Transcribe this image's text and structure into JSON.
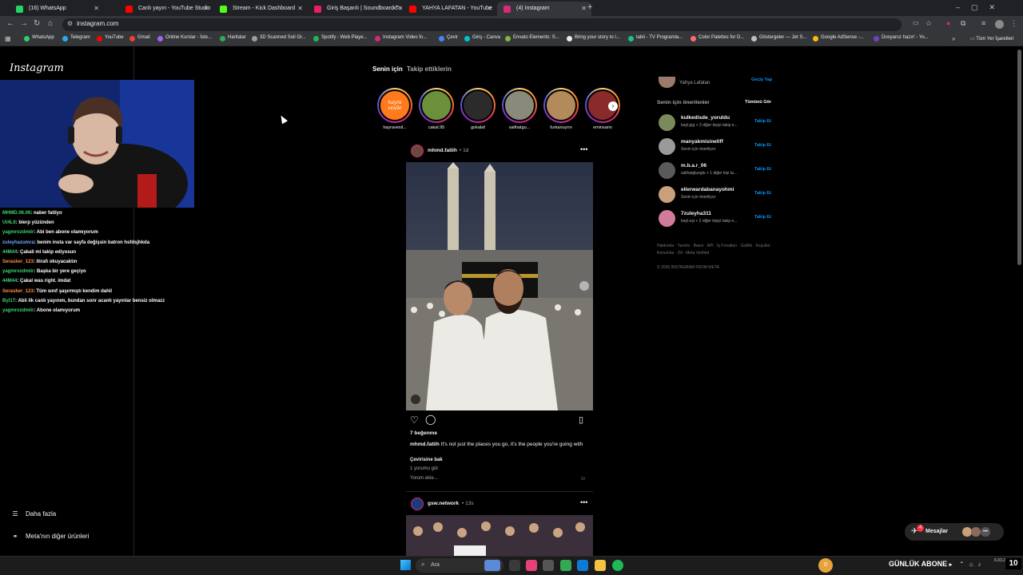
{
  "tabs": [
    {
      "title": "(16) WhatsApp",
      "color": "#25d366"
    },
    {
      "title": "Canlı yayın - YouTube Studio",
      "color": "#ff0000"
    },
    {
      "title": "Stream - Kick Dashboard",
      "color": "#53fc18"
    },
    {
      "title": "Giriş Başarılı | Soundboard Tarı",
      "color": "#e91e63"
    },
    {
      "title": "YAHYA LAFATAN - YouTube",
      "color": "#ff0000"
    },
    {
      "title": "(4) Instagram",
      "color": "#d62976"
    }
  ],
  "new_tab_label": "+",
  "address": {
    "url": "instagram.com"
  },
  "bookmarks": [
    {
      "label": "WhatsApp",
      "color": "#25d366"
    },
    {
      "label": "Telegram",
      "color": "#2aabee"
    },
    {
      "label": "YouTube",
      "color": "#ff0000"
    },
    {
      "label": "Gmail",
      "color": "#ea4335"
    },
    {
      "label": "Online Kurslar - İste...",
      "color": "#a463f2"
    },
    {
      "label": "Haritalar",
      "color": "#34a853"
    },
    {
      "label": "3D Scanned Soil Gr...",
      "color": "#9aa0a6"
    },
    {
      "label": "Spotify - Web Playe...",
      "color": "#1db954"
    },
    {
      "label": "Instagram Video İn...",
      "color": "#d62976"
    },
    {
      "label": "Çevir",
      "color": "#4285f4"
    },
    {
      "label": "Giriş - Canva",
      "color": "#00c4cc"
    },
    {
      "label": "Envato Elements: S...",
      "color": "#82b541"
    },
    {
      "label": "Bring your story to l...",
      "color": "#e8eaed"
    },
    {
      "label": "tabii - TV Programla...",
      "color": "#19c37d"
    },
    {
      "label": "Color Palettes for D...",
      "color": "#ff6b6b"
    },
    {
      "label": "Göstergeler — Jet S...",
      "color": "#bdc1c6"
    },
    {
      "label": "Google AdSense -...",
      "color": "#fbbc04"
    },
    {
      "label": "Dosyanız hazır! - Yo...",
      "color": "#6f42c1"
    }
  ],
  "bookmarks_overflow": "»",
  "all_bookmarks": "Tüm Yer İşaretleri",
  "instagram": {
    "logo": "Instagram",
    "feed_tabs": [
      "Senin için",
      "Takip ettiklerin"
    ],
    "stories": [
      {
        "user": "hayravesil...",
        "color": "#ff7a1a",
        "label": "hayra vesile"
      },
      {
        "user": "cakal.95",
        "color": "#6b8f3a"
      },
      {
        "user": "gokalaf",
        "color": "#2b2b2b"
      },
      {
        "user": "salihatgu...",
        "color": "#8a8a7a"
      },
      {
        "user": "furkanuyrın",
        "color": "#b38a5a"
      },
      {
        "user": "eminsann",
        "color": "#8a2b2b"
      }
    ],
    "post": {
      "author": "mhmd.fatiih",
      "time": "1d",
      "likes": "7 beğenme",
      "caption_user": "mhmd.fatiih",
      "caption": "It's not just the places you go, it's the people you're going with",
      "translate": "Çevirisine bak",
      "comments_link": "1 yorumu gör",
      "comment_placeholder": "Yorum ekle..."
    },
    "post2": {
      "author": "gsw.network",
      "time": "13s"
    },
    "more": "Daha fazla",
    "meta_products": "Meta'nın diğer ürünleri",
    "suggest": {
      "current_user": "Yahya Lafatan",
      "switch": "Geçiş Yap",
      "header": "Senin için önerilenler",
      "see_all": "Tümünü Gör",
      "follow": "Takip Et",
      "users": [
        {
          "name": "kulkedisde_yoruldu",
          "sub": "bayl.jpg + 3 diğer kişiyi takip e...",
          "color": "#7a8a5a"
        },
        {
          "name": "manyakmisineliff",
          "sub": "Senin için öneriliyor",
          "color": "#9a9a9a"
        },
        {
          "name": "m.b.a.r_06",
          "sub": "salihatgluoglu + 1 diğer kişi ta...",
          "color": "#5a5a5a"
        },
        {
          "name": "ellerwardabanayohmi",
          "sub": "Senin için öneriliyor",
          "color": "#c9a07a"
        },
        {
          "name": "7zuleyha311",
          "sub": "bayl.eşi + 2 diğer kişiyi takip e...",
          "color": "#d27a9a"
        }
      ],
      "footer_links": "Hakkında · Yardım · Basın · API · İş Fırsatları · Gizlilik · Koşullar · Konumlar · Dil · Meta Verified",
      "copyright": "© 2026 INSTAGRAM FROM META"
    },
    "messages": "Mesajlar",
    "messages_badge": "4"
  },
  "chat": [
    {
      "name": "MHMD.06.06",
      "text": ": naber fatiiyo",
      "cls": ""
    },
    {
      "name": "Ut4L6",
      "text": ": blerp yüzünden",
      "cls": ""
    },
    {
      "name": "yagmrozdmiir",
      "text": ": Abi ben abone olamıyorum",
      "cls": ""
    },
    {
      "name": "zuleyhazumra",
      "text": ": benim insta var sayfa değişsin batron hsfdsjhkda",
      "cls": "blue"
    },
    {
      "name": "44M44",
      "text": ": Çakali mi takip ediyosun",
      "cls": ""
    },
    {
      "name": "Serasker_123",
      "text": ": itirafı okuyacaktın",
      "cls": "orange"
    },
    {
      "name": "yagmrozdmiir",
      "text": ": Başka bir yere geçiyo",
      "cls": ""
    },
    {
      "name": "44M44",
      "text": ": Çakal was right. imdat",
      "cls": ""
    },
    {
      "name": "Serasker_123",
      "text": ": Tüm sınıf şaşırmıştı kendim dahil",
      "cls": "orange"
    },
    {
      "name": "Byl17",
      "text": ": Abii ilk canlı yayınım, bundan sonr acanlı yayınlar bensiz olmazz",
      "cls": ""
    },
    {
      "name": "yagmrozdmiir",
      "text": ": Abone olamıyorum",
      "cls": ""
    }
  ],
  "taskbar": {
    "search": "Ara",
    "ticker": "GÜNLÜK ABONE",
    "counter": "10",
    "date": "6.03.2026"
  }
}
